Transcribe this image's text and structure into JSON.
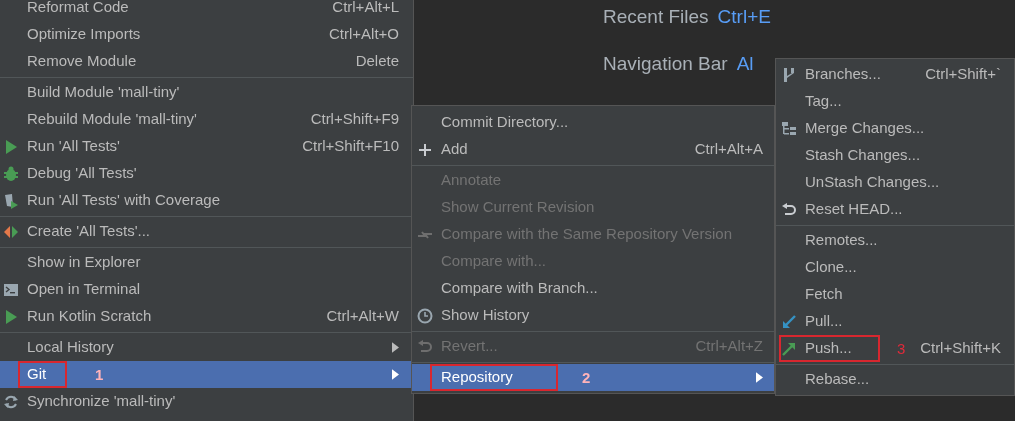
{
  "editor_hints": [
    {
      "label": "Recent Files",
      "shortcut": "Ctrl+E"
    },
    {
      "label": "Navigation Bar",
      "shortcut": "Al"
    }
  ],
  "menus": [
    {
      "sections": [
        [
          {
            "label": "Reformat Code",
            "shortcut": "Ctrl+Alt+L",
            "selected": false,
            "submenu": false
          },
          {
            "label": "Optimize Imports",
            "shortcut": "Ctrl+Alt+O",
            "selected": false,
            "submenu": false
          },
          {
            "label": "Remove Module",
            "shortcut": "Delete",
            "selected": false,
            "submenu": false
          }
        ],
        [
          {
            "label": "Build Module 'mall-tiny'",
            "selected": false,
            "submenu": false
          },
          {
            "label": "Rebuild Module 'mall-tiny'",
            "shortcut": "Ctrl+Shift+F9",
            "selected": false,
            "submenu": false
          },
          {
            "label": "Run 'All Tests'",
            "shortcut": "Ctrl+Shift+F10",
            "selected": false,
            "submenu": false
          },
          {
            "label": "Debug 'All Tests'",
            "selected": false,
            "submenu": false
          },
          {
            "label": "Run 'All Tests' with Coverage",
            "selected": false,
            "submenu": false
          }
        ],
        [
          {
            "label": "Create 'All Tests'...",
            "selected": false,
            "submenu": false
          }
        ],
        [
          {
            "label": "Show in Explorer",
            "selected": false,
            "submenu": false
          },
          {
            "label": "Open in Terminal",
            "selected": false,
            "submenu": false
          },
          {
            "label": "Run Kotlin Scratch",
            "shortcut": "Ctrl+Alt+W",
            "selected": false,
            "submenu": false
          }
        ],
        [
          {
            "label": "Local History",
            "selected": false,
            "submenu": true
          },
          {
            "label": "Git",
            "selected": true,
            "submenu": true,
            "callout": "1"
          },
          {
            "label": "Synchronize 'mall-tiny'",
            "selected": false,
            "submenu": false
          }
        ]
      ]
    },
    {
      "sections": [
        [
          {
            "label": "Commit Directory...",
            "selected": false,
            "disabled": false,
            "submenu": false
          },
          {
            "label": "Add",
            "shortcut": "Ctrl+Alt+A",
            "selected": false,
            "disabled": false,
            "submenu": false
          }
        ],
        [
          {
            "label": "Annotate",
            "selected": false,
            "disabled": true,
            "submenu": false
          },
          {
            "label": "Show Current Revision",
            "selected": false,
            "disabled": true,
            "submenu": false
          },
          {
            "label": "Compare with the Same Repository Version",
            "selected": false,
            "disabled": true,
            "submenu": false
          },
          {
            "label": "Compare with...",
            "selected": false,
            "disabled": true,
            "submenu": false
          },
          {
            "label": "Compare with Branch...",
            "selected": false,
            "disabled": false,
            "submenu": false
          },
          {
            "label": "Show History",
            "selected": false,
            "disabled": false,
            "submenu": false
          }
        ],
        [
          {
            "label": "Revert...",
            "shortcut": "Ctrl+Alt+Z",
            "selected": false,
            "disabled": true,
            "submenu": false
          }
        ],
        [
          {
            "label": "Repository",
            "selected": true,
            "disabled": false,
            "submenu": true,
            "callout": "2"
          }
        ]
      ]
    },
    {
      "sections": [
        [
          {
            "label": "Branches...",
            "shortcut": "Ctrl+Shift+`",
            "selected": false,
            "submenu": false
          },
          {
            "label": "Tag...",
            "selected": false,
            "submenu": false
          },
          {
            "label": "Merge Changes...",
            "selected": false,
            "submenu": false
          },
          {
            "label": "Stash Changes...",
            "selected": false,
            "submenu": false
          },
          {
            "label": "UnStash Changes...",
            "selected": false,
            "submenu": false
          },
          {
            "label": "Reset HEAD...",
            "selected": false,
            "submenu": false
          }
        ],
        [
          {
            "label": "Remotes...",
            "selected": false,
            "submenu": false
          },
          {
            "label": "Clone...",
            "selected": false,
            "submenu": false
          },
          {
            "label": "Fetch",
            "selected": false,
            "submenu": false
          },
          {
            "label": "Pull...",
            "selected": false,
            "submenu": false
          },
          {
            "label": "Push...",
            "shortcut": "Ctrl+Shift+K",
            "selected": false,
            "submenu": false,
            "callout": "3"
          }
        ],
        [
          {
            "label": "Rebase...",
            "selected": false,
            "submenu": false
          }
        ]
      ]
    }
  ]
}
